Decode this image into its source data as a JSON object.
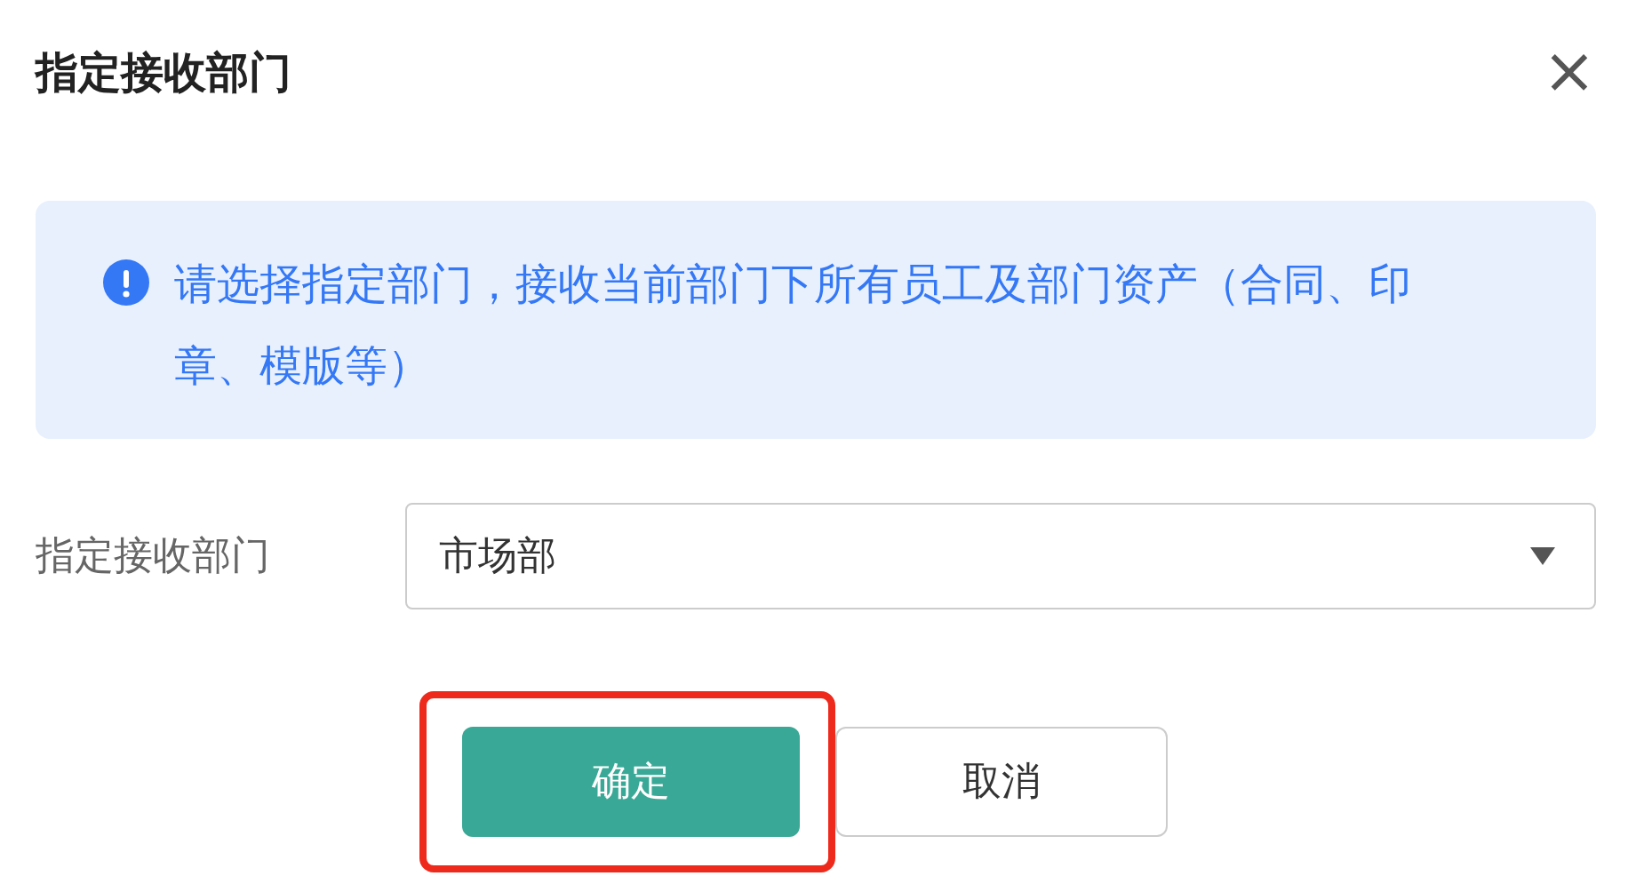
{
  "dialog": {
    "title": "指定接收部门",
    "close": "×"
  },
  "notice": {
    "text": "请选择指定部门，接收当前部门下所有员工及部门资产（合同、印章、模版等）"
  },
  "field": {
    "label": "指定接收部门",
    "value": "市场部"
  },
  "buttons": [
    {
      "label": "确定",
      "kind": "primary",
      "highlighted": true
    },
    {
      "label": "取消",
      "kind": "secondary",
      "highlighted": false
    }
  ]
}
